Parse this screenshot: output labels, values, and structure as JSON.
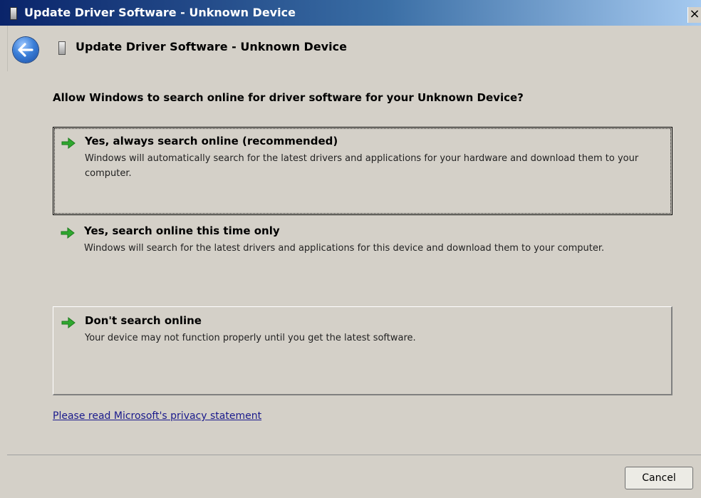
{
  "window": {
    "title": "Update Driver Software - Unknown Device",
    "close_glyph": "×"
  },
  "header": {
    "back_icon": "back-arrow-icon",
    "title": "Update Driver Software - Unknown Device"
  },
  "content": {
    "question": "Allow Windows to search online for driver software for your Unknown Device?",
    "options": [
      {
        "title": "Yes, always search online (recommended)",
        "description": "Windows will automatically search for the latest drivers and applications for your hardware and download them to your computer."
      },
      {
        "title": "Yes, search online this time only",
        "description": "Windows will search for the latest drivers and applications for this device and download them to your computer."
      },
      {
        "title": "Don't search online",
        "description": "Your device may not function properly until you get the latest software."
      }
    ],
    "privacy_link": "Please read Microsoft's  privacy statement"
  },
  "footer": {
    "cancel_label": "Cancel"
  },
  "colors": {
    "title_bar": "#0a246a",
    "arrow_green": "#2fa82f",
    "link": "#1a1a8c",
    "window_bg": "#d4d0c8"
  }
}
